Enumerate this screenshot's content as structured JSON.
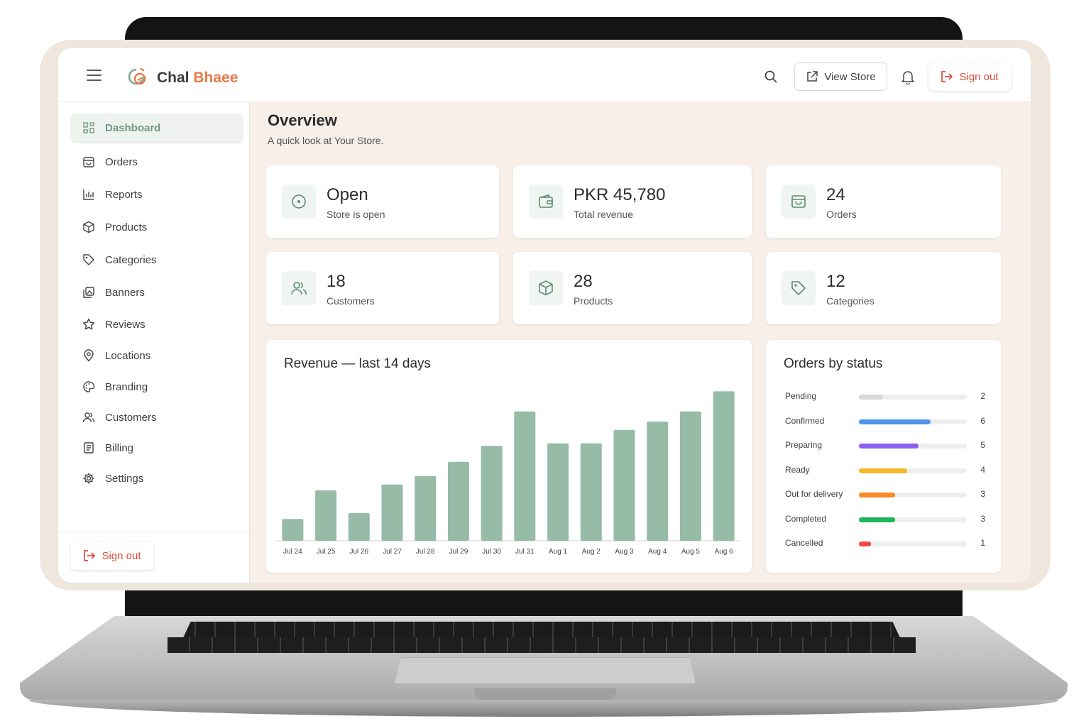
{
  "app": {
    "brand_first": "Chal",
    "brand_second": "Bhaee",
    "accent": "#ea7a4b",
    "primary": "#6f9a84"
  },
  "topbar": {
    "view_store": "View Store",
    "sign_out": "Sign out"
  },
  "sidebar": {
    "items": [
      {
        "label": "Dashboard",
        "icon": "grid-icon"
      },
      {
        "label": "Orders",
        "icon": "bag-icon"
      },
      {
        "label": "Reports",
        "icon": "bar-chart-icon"
      },
      {
        "label": "Products",
        "icon": "box-icon"
      },
      {
        "label": "Categories",
        "icon": "tag-icon"
      },
      {
        "label": "Banners",
        "icon": "image-icon"
      },
      {
        "label": "Reviews",
        "icon": "star-icon"
      },
      {
        "label": "Locations",
        "icon": "pin-icon"
      },
      {
        "label": "Branding",
        "icon": "palette-icon"
      },
      {
        "label": "Customers",
        "icon": "users-icon"
      },
      {
        "label": "Billing",
        "icon": "receipt-icon"
      },
      {
        "label": "Settings",
        "icon": "gear-icon"
      }
    ],
    "sign_out": "Sign out"
  },
  "main": {
    "title": "Overview",
    "subtitle": "A quick look at Your Store.",
    "stats": [
      {
        "value": "Open",
        "label": "Store is open",
        "icon": "store-status-icon"
      },
      {
        "value": "PKR 45,780",
        "label": "Total revenue",
        "icon": "wallet-icon"
      },
      {
        "value": "24",
        "label": "Orders",
        "icon": "bag-icon"
      },
      {
        "value": "18",
        "label": "Customers",
        "icon": "users-icon"
      },
      {
        "value": "28",
        "label": "Products",
        "icon": "box-icon"
      },
      {
        "value": "12",
        "label": "Categories",
        "icon": "tag-icon"
      }
    ],
    "revenue_title": "Revenue — last 14 days",
    "orders_title": "Orders by status"
  },
  "chart_data": [
    {
      "type": "bar",
      "title": "Revenue — last 14 days",
      "categories": [
        "Jul 24",
        "Jul 25",
        "Jul 26",
        "Jul 27",
        "Jul 28",
        "Jul 29",
        "Jul 30",
        "Jul 31",
        "Aug 1",
        "Aug 2",
        "Aug 3",
        "Aug 4",
        "Aug 5",
        "Aug 6"
      ],
      "values": [
        1300,
        3000,
        1650,
        3350,
        3850,
        4700,
        5650,
        7700,
        5800,
        5800,
        6600,
        7100,
        7700,
        8900
      ],
      "ylim": [
        0,
        9000
      ],
      "grid": false,
      "color": "#96bba6"
    },
    {
      "type": "bar",
      "title": "Orders by status",
      "categories": [
        "Pending",
        "Confirmed",
        "Preparing",
        "Ready",
        "Out for delivery",
        "Completed",
        "Cancelled"
      ],
      "values": [
        2,
        6,
        5,
        4,
        3,
        3,
        1
      ],
      "max": 9,
      "colors": [
        "#d9d9d9",
        "#4f94ef",
        "#8d5ef0",
        "#f5b829",
        "#f98a26",
        "#21b55b",
        "#ef4a4a"
      ]
    }
  ]
}
